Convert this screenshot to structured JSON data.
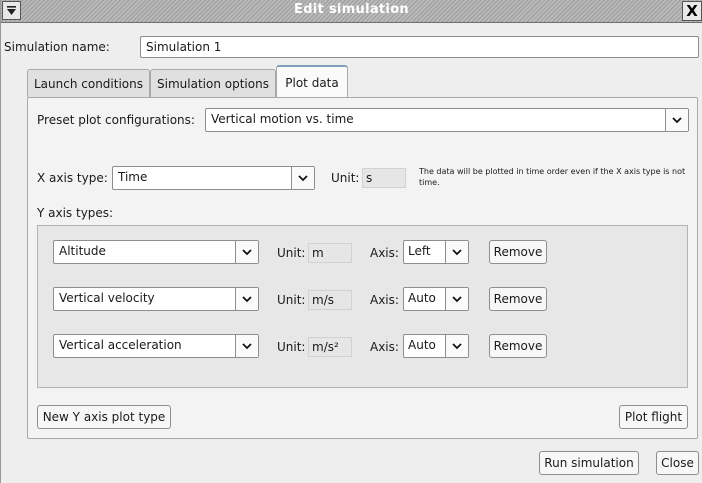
{
  "window": {
    "title": "Edit simulation",
    "menu_icon": "menu-arrow-icon",
    "close_label": "X"
  },
  "simulation_name": {
    "label": "Simulation name:",
    "value": "Simulation 1"
  },
  "tabs": [
    {
      "label": "Launch conditions"
    },
    {
      "label": "Simulation options"
    },
    {
      "label": "Plot data"
    }
  ],
  "preset": {
    "label": "Preset plot configurations:",
    "value": "Vertical motion vs. time"
  },
  "x_axis": {
    "label": "X axis type:",
    "value": "Time",
    "unit_label": "Unit:",
    "unit_value": "s",
    "note": "The data will be plotted in time order even if the X axis type is not time."
  },
  "y_axis": {
    "label": "Y axis types:",
    "rows": [
      {
        "type": "Altitude",
        "unit_label": "Unit:",
        "unit": "m",
        "axis_label": "Axis:",
        "axis": "Left",
        "remove": "Remove"
      },
      {
        "type": "Vertical velocity",
        "unit_label": "Unit:",
        "unit": "m/s",
        "axis_label": "Axis:",
        "axis": "Auto",
        "remove": "Remove"
      },
      {
        "type": "Vertical acceleration",
        "unit_label": "Unit:",
        "unit": "m/s²",
        "axis_label": "Axis:",
        "axis": "Auto",
        "remove": "Remove"
      }
    ]
  },
  "buttons": {
    "new_y": "New Y axis plot type",
    "plot_flight": "Plot flight",
    "run_simulation": "Run simulation",
    "close": "Close"
  }
}
